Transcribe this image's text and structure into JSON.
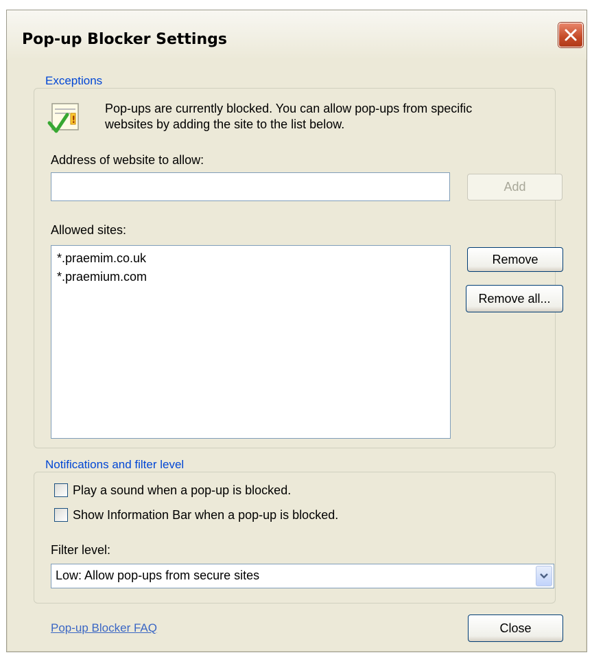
{
  "dialog": {
    "title": "Pop-up Blocker Settings",
    "close_icon": "close-x-icon"
  },
  "exceptions": {
    "legend": "Exceptions",
    "info_icon": "popup-allowed-icon",
    "info_line1": "Pop-ups are currently blocked.  You can allow pop-ups from specific",
    "info_line2": "websites by adding the site to the list below.",
    "address_label": "Address of website to allow:",
    "address_value": "",
    "add_label": "Add",
    "allowed_label": "Allowed sites:",
    "allowed_sites": [
      "*.praemim.co.uk",
      "*.praemium.com"
    ],
    "remove_label": "Remove",
    "remove_all_label": "Remove all..."
  },
  "notifications": {
    "legend": "Notifications and filter level",
    "play_sound_label": "Play a sound when a pop-up is blocked.",
    "play_sound_checked": false,
    "info_bar_label": "Show Information Bar when a pop-up is blocked.",
    "info_bar_checked": false,
    "filter_label": "Filter level:",
    "filter_value": "Low: Allow pop-ups from secure sites"
  },
  "footer": {
    "faq_link": "Pop-up Blocker FAQ",
    "close_label": "Close"
  },
  "colors": {
    "dialog_bg": "#ece9d8",
    "legend_blue": "#0046d5",
    "link_blue": "#3a66c4",
    "close_red": "#c44a27"
  }
}
